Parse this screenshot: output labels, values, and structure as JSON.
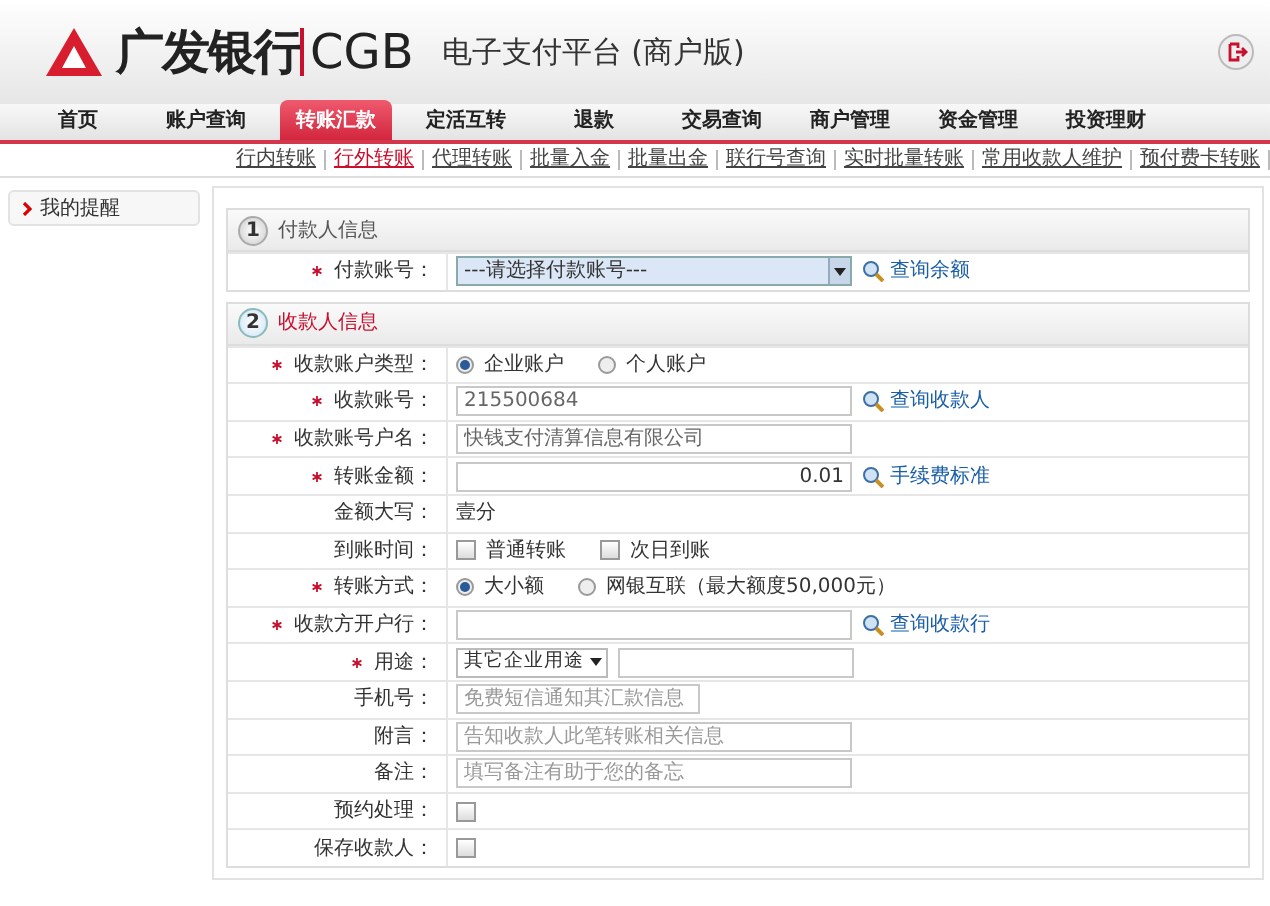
{
  "header": {
    "bank_name": "广发银行",
    "bank_code": "CGB",
    "platform_title": "电子支付平台 (商户版)"
  },
  "nav": [
    {
      "label": "首页",
      "selected": false
    },
    {
      "label": "账户查询",
      "selected": false
    },
    {
      "label": "转账汇款",
      "selected": true
    },
    {
      "label": "定活互转",
      "selected": false
    },
    {
      "label": "退款",
      "selected": false
    },
    {
      "label": "交易查询",
      "selected": false
    },
    {
      "label": "商户管理",
      "selected": false
    },
    {
      "label": "资金管理",
      "selected": false
    },
    {
      "label": "投资理财",
      "selected": false
    }
  ],
  "subnav": [
    {
      "label": "行内转账",
      "selected": false
    },
    {
      "label": "行外转账",
      "selected": true
    },
    {
      "label": "代理转账",
      "selected": false
    },
    {
      "label": "批量入金",
      "selected": false
    },
    {
      "label": "批量出金",
      "selected": false
    },
    {
      "label": "联行号查询",
      "selected": false
    },
    {
      "label": "实时批量转账",
      "selected": false
    },
    {
      "label": "常用收款人维护",
      "selected": false
    },
    {
      "label": "预付费卡转账",
      "selected": false
    }
  ],
  "sidebar": [
    {
      "label": "我的提醒"
    }
  ],
  "sections": [
    {
      "number": "1",
      "title": "付款人信息",
      "active": false,
      "rows": [
        {
          "kind": "select",
          "label": "付款账号：",
          "required": true,
          "value": "---请选择付款账号---",
          "link": "查询余额"
        }
      ]
    },
    {
      "number": "2",
      "title": "收款人信息",
      "active": true,
      "rows": [
        {
          "kind": "radio",
          "label": "收款账户类型：",
          "required": true,
          "options": [
            {
              "label": "企业账户",
              "selected": true
            },
            {
              "label": "个人账户",
              "selected": false
            }
          ]
        },
        {
          "kind": "input",
          "label": "收款账号：",
          "required": true,
          "value": "215500684",
          "link": "查询收款人"
        },
        {
          "kind": "input",
          "label": "收款账号户名：",
          "required": true,
          "value": "快钱支付清算信息有限公司"
        },
        {
          "kind": "amount",
          "label": "转账金额：",
          "required": true,
          "value": "0.01",
          "link": "手续费标准"
        },
        {
          "kind": "text",
          "label": "金额大写：",
          "required": false,
          "value": "壹分"
        },
        {
          "kind": "checkbox",
          "label": "到账时间：",
          "required": false,
          "options": [
            {
              "label": "普通转账",
              "checked": false
            },
            {
              "label": "次日到账",
              "checked": false
            }
          ]
        },
        {
          "kind": "radio",
          "label": "转账方式：",
          "required": true,
          "options": [
            {
              "label": "大小额",
              "selected": true
            },
            {
              "label": "网银互联（最大额度50,000元）",
              "selected": false
            }
          ]
        },
        {
          "kind": "input",
          "label": "收款方开户行：",
          "required": true,
          "link": "查询收款行"
        },
        {
          "kind": "select_input",
          "label": "用途：",
          "required": true,
          "value": "其它企业用途"
        },
        {
          "kind": "input",
          "label": "手机号：",
          "required": false,
          "placeholder": "免费短信通知其汇款信息",
          "short": true
        },
        {
          "kind": "input",
          "label": "附言：",
          "required": false,
          "placeholder": "告知收款人此笔转账相关信息"
        },
        {
          "kind": "input",
          "label": "备注：",
          "required": false,
          "placeholder": "填写备注有助于您的备忘"
        },
        {
          "kind": "checkbox",
          "label": "预约处理：",
          "required": false,
          "options": [
            {
              "checked": false
            }
          ]
        },
        {
          "kind": "checkbox",
          "label": "保存收款人：",
          "required": false,
          "options": [
            {
              "checked": false
            }
          ]
        }
      ]
    }
  ]
}
